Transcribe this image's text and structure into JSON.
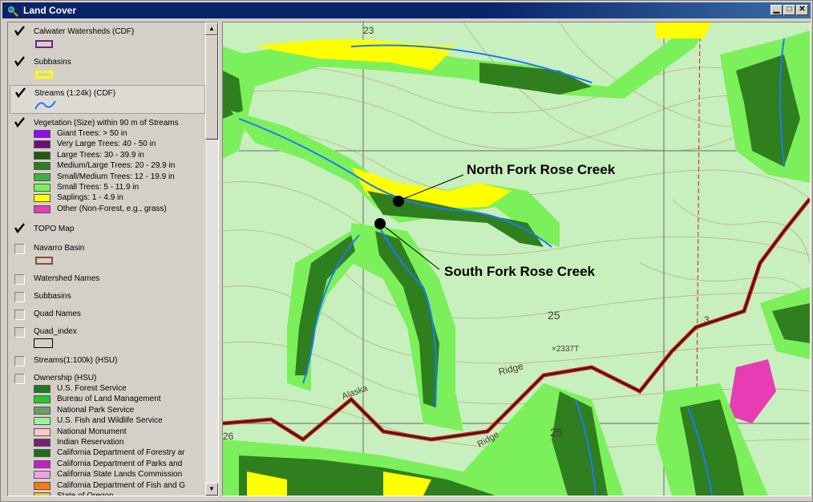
{
  "window": {
    "title": "Land Cover",
    "app_icon": "search-globe-icon"
  },
  "toc": {
    "layers": [
      {
        "name": "Calwater Watersheds (CDF)",
        "checked": true,
        "symbol": "purple-outline-box"
      },
      {
        "name": "Subbasins",
        "checked": true,
        "symbol": "yellow-outline-box"
      },
      {
        "name": "Streams (1:24k) (CDF)",
        "checked": true,
        "symbol": "blue-wavy-line"
      },
      {
        "name": "Vegetation (Size) within 90 m  of Streams",
        "checked": true
      },
      {
        "name": "TOPO Map",
        "checked": true
      },
      {
        "name": "Navarro Basin",
        "checked": false,
        "symbol": "brown-outline-box"
      },
      {
        "name": "Watershed Names",
        "checked": false
      },
      {
        "name": "Subbasins",
        "checked": false
      },
      {
        "name": "Quad Names",
        "checked": false
      },
      {
        "name": "Quad_index",
        "checked": false,
        "symbol": "black-outline-box"
      },
      {
        "name": "Streams(1:100k) (HSU)",
        "checked": false
      },
      {
        "name": "Ownership (HSU)",
        "checked": false
      }
    ],
    "vegetation_legend": [
      {
        "label": "Giant Trees: > 50 in",
        "color": "#9b00ff"
      },
      {
        "label": "Very Large Trees: 40 - 50 in",
        "color": "#6a0f7a"
      },
      {
        "label": "Large Trees: 30 - 39.9 in",
        "color": "#1e5a14"
      },
      {
        "label": "Medium/Large Trees: 20 - 29.9 in",
        "color": "#2f7f1f"
      },
      {
        "label": "Small/Medium Trees: 12 - 19.9 in",
        "color": "#3cb43c"
      },
      {
        "label": "Small Trees: 5 - 11.9 in",
        "color": "#7cf05a"
      },
      {
        "label": "Saplings: 1 - 4.9 in",
        "color": "#ffff00"
      },
      {
        "label": "Other (Non-Forest, e.g., grass)",
        "color": "#e63cb4"
      }
    ],
    "ownership_legend": [
      {
        "label": "U.S. Forest Service",
        "color": "#1e7a1e"
      },
      {
        "label": "Bureau of Land Management",
        "color": "#28c828"
      },
      {
        "label": "National Park Service",
        "color": "#6aa06a"
      },
      {
        "label": "U.S. Fish and Wildlife Service",
        "color": "#a0f0a0"
      },
      {
        "label": "National Monument",
        "color": "#ffc8c8"
      },
      {
        "label": "Indian Reservation",
        "color": "#7a1e7a"
      },
      {
        "label": "California Department of Forestry ar",
        "color": "#1e6e1e"
      },
      {
        "label": "California Department of Parks and",
        "color": "#c81ec8"
      },
      {
        "label": "California State Lands Commission",
        "color": "#f0a0f0"
      },
      {
        "label": "California Department of Fish and G",
        "color": "#ff7814"
      },
      {
        "label": "State of Oregon",
        "color": "#e6c83c"
      }
    ]
  },
  "map": {
    "labels": {
      "north_fork": "North Fork Rose Creek",
      "south_fork": "South Fork Rose Creek"
    },
    "topo_text": {
      "ridge": "Ridge",
      "elev": "×2337T",
      "num25a": "25",
      "num25b": "25",
      "num26": "26",
      "num23": "23",
      "alaska": "Alaska",
      "ridge2": "Ridge",
      "num3": "3"
    }
  }
}
